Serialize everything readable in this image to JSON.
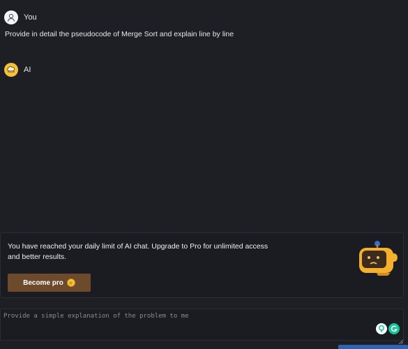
{
  "conversation": {
    "user": {
      "name": "You",
      "message": "Provide in detail the pseudocode of Merge Sort and explain line by line"
    },
    "ai": {
      "name": "AI"
    }
  },
  "limit_notice": {
    "text": "You have reached your daily limit of AI chat. Upgrade to Pro for unlimited access and better results.",
    "button_label": "Become pro"
  },
  "composer": {
    "placeholder": "Provide a simple explanation of the problem to me",
    "value": ""
  },
  "colors": {
    "background": "#1e1f24",
    "pro_button": "#6e4a2c",
    "ai_avatar": "#f5c03a",
    "send_button": "#2c64b6",
    "grammarly": "#15c39a"
  },
  "icons": {
    "user_avatar": "user-icon",
    "ai_avatar": "chef-hat-icon",
    "coin": "coin-icon",
    "mascot": "robot-mascot-icon",
    "extension_1": "bulb-icon",
    "extension_2": "grammarly-icon"
  }
}
